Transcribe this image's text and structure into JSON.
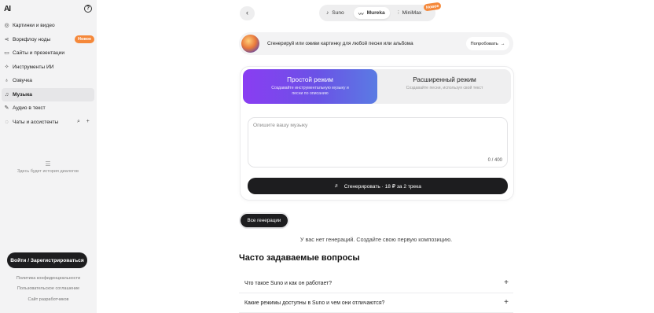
{
  "sidebar": {
    "logo": "AI",
    "items": [
      {
        "label": "Картинки и видео",
        "icon": "image-icon"
      },
      {
        "label": "Воркфлоу ноды",
        "icon": "workflow-icon",
        "badge": "Новое"
      },
      {
        "label": "Сайты и презентации",
        "icon": "monitor-icon"
      },
      {
        "label": "Инструменты ИИ",
        "icon": "tools-icon"
      },
      {
        "label": "Озвучка",
        "icon": "microphone-icon"
      },
      {
        "label": "Музыка",
        "icon": "music-icon",
        "active": true
      },
      {
        "label": "Аудио в текст",
        "icon": "audio-text-icon"
      },
      {
        "label": "Чаты и ассистенты",
        "icon": "chat-icon"
      }
    ],
    "empty_history": "Здесь будет история диалогов",
    "login_label": "Войти / Зарегистрироваться",
    "footer": [
      "Политика конфиденциальности",
      "Пользовательское соглашение",
      "Сайт разработчиков"
    ]
  },
  "providers": {
    "tabs": [
      "Suno",
      "Mureka",
      "MiniMax"
    ],
    "selected": "Mureka",
    "badge": "Новое"
  },
  "promo": {
    "text": "Сгенерируй или оживи картинку для любой песни или альбома",
    "button": "Попробовать"
  },
  "modes": {
    "simple": {
      "title": "Простой режим",
      "desc": "Создавайте инструментальную музыку и песни по описанию"
    },
    "advanced": {
      "title": "Расширенный режим",
      "desc": "Создавайте песни, используя свой текст"
    }
  },
  "prompt": {
    "placeholder": "Опишите вашу музыку",
    "counter": "0 / 400"
  },
  "generate_label": "Сгенерировать · 18 ₽ за 2 трека",
  "all_generations_label": "Все генерации",
  "no_generations": "У вас нет генераций. Создайте свою первую композицию.",
  "faq": {
    "title": "Часто задаваемые вопросы",
    "items": [
      "Что такое Suno и как он работает?",
      "Какие режимы доступны в Suno и чем они отличаются?"
    ]
  },
  "colors": {
    "accent_badge": "#f5883a",
    "mode_gradient_start": "#8a3df2",
    "mode_gradient_end": "#5a7be3",
    "dark_button": "#1d1d1f"
  }
}
